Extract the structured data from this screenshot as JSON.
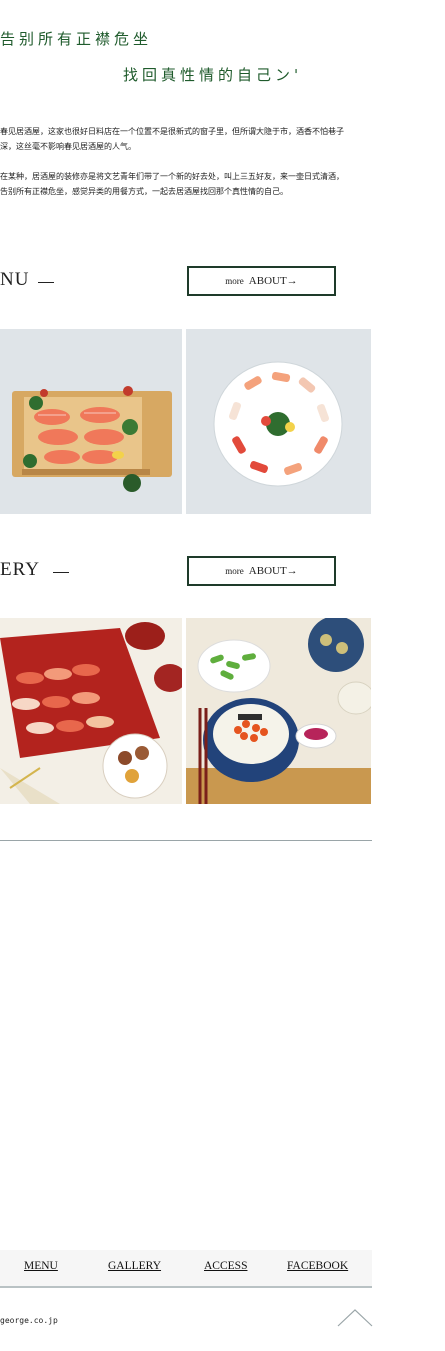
{
  "hero": {
    "line1": "告别所有正襟危坐",
    "line2": "找回真性情的自己ン'"
  },
  "intro": {
    "p1": "春见居酒屋，这家也很好日料店在一个位置不是很新式的窗子里，但所谓大隐于市，酒香不怕巷子深，这丝毫不影响春见居酒屋的人气。",
    "p2": "在某种，居酒屋的装修亦是将文艺青年们带了一个新的好去处，叫上三五好友，来一壶日式清酒，告别所有正襟危坐，感觉异类的用餐方式，一起去居酒屋找回那个真性情的自己。"
  },
  "menu_section": {
    "title": "NU",
    "more_small": "more",
    "more_label": "ABOUT→"
  },
  "gallery_section": {
    "title": "ERY",
    "more_small": "more",
    "more_label": "ABOUT→"
  },
  "footer": {
    "nav": [
      "MENU",
      "GALLERY",
      "ACCESS",
      "FACEBOOK"
    ],
    "email": "george.co.jp"
  },
  "colors": {
    "accent_green": "#1f5b2c",
    "button_border": "#1e3b2a",
    "tile_bg": "#dfe4e8"
  },
  "icons": {
    "back_to_top": "chevron-up-icon"
  }
}
